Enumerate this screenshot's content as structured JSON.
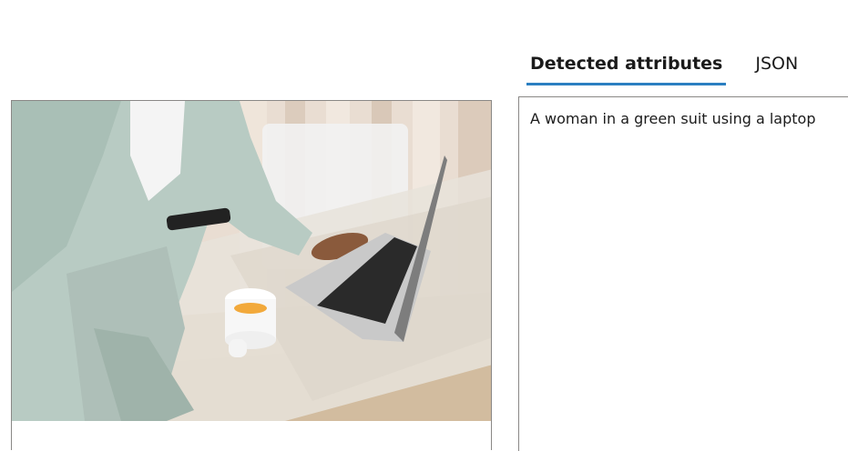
{
  "tabs": [
    {
      "label": "Detected attributes",
      "selected": true
    },
    {
      "label": "JSON",
      "selected": false
    }
  ],
  "result": {
    "caption": "A woman in a green suit using a laptop"
  },
  "colors": {
    "tab_underline": "#2b7fc1",
    "border": "#8a8886"
  },
  "image": {
    "description_icon": "photo"
  }
}
